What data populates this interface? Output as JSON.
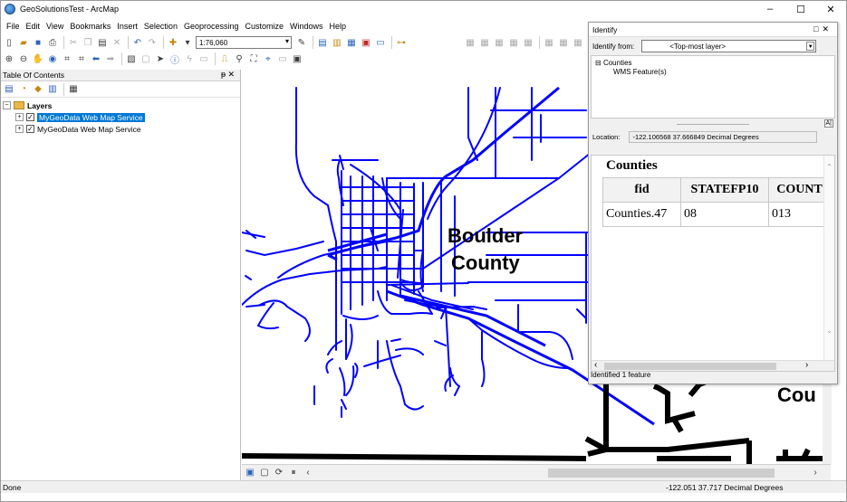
{
  "window": {
    "title": "GeoSolutionsTest - ArcMap",
    "minimize": "–",
    "maximize": "☐",
    "close": "✕"
  },
  "menu": [
    "File",
    "Edit",
    "View",
    "Bookmarks",
    "Insert",
    "Selection",
    "Geoprocessing",
    "Customize",
    "Windows",
    "Help"
  ],
  "toolbar": {
    "scale_value": "1:76,060"
  },
  "toc": {
    "title": "Table Of Contents",
    "root_label": "Layers",
    "layers": [
      {
        "label": "MyGeoData Web Map Service",
        "checked": true,
        "selected": true
      },
      {
        "label": "MyGeoData Web Map Service",
        "checked": true,
        "selected": false
      }
    ]
  },
  "map": {
    "label_boulder_line1": "Boulder",
    "label_boulder_line2": "County",
    "label_partial": "Cou",
    "road_color": "#0000ff"
  },
  "identify": {
    "title": "Identify",
    "from_label": "Identify from:",
    "from_value": "<Top-most layer>",
    "tree_root": "Counties",
    "tree_child": "WMS Feature(s)",
    "location_label": "Location:",
    "location_value": "-122.106568  37.666849 Decimal Degrees",
    "pane_title": "Counties",
    "columns": [
      "fid",
      "STATEFP10",
      "COUNT"
    ],
    "row": [
      "Counties.47",
      "08",
      "013"
    ],
    "status": "Identified 1 feature"
  },
  "status": {
    "left": "Done",
    "coords": "-122.051  37.717 Decimal Degrees"
  }
}
